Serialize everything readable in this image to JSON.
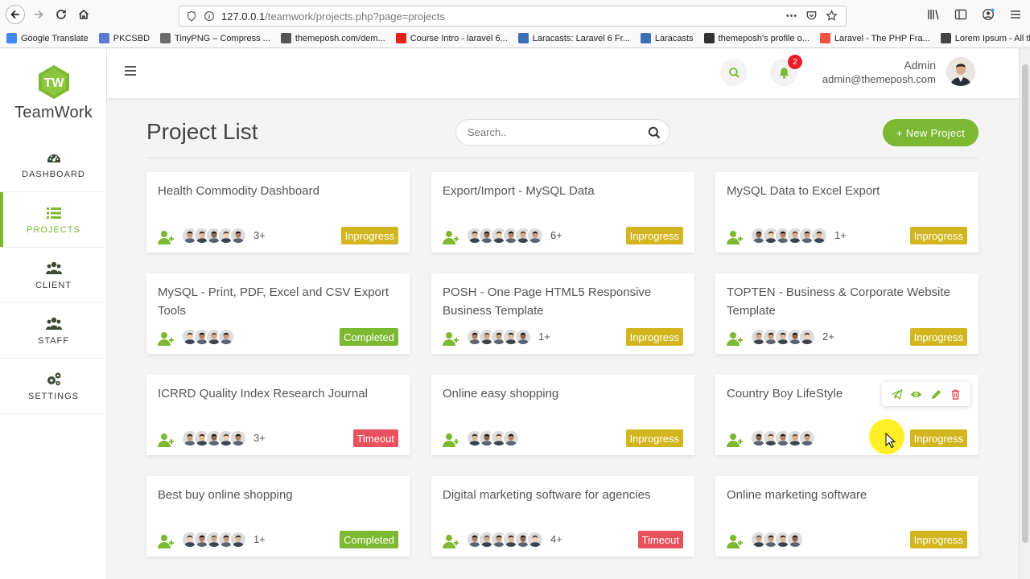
{
  "browser": {
    "url_host": "127.0.0.1",
    "url_path": "/teamwork/projects.php?page=projects",
    "bookmarks": [
      {
        "label": "Google Translate",
        "color": "#4285f4"
      },
      {
        "label": "PKCSBD",
        "color": "#5a7bd1"
      },
      {
        "label": "TinyPNG – Compress ...",
        "color": "#6b6b6b"
      },
      {
        "label": "themeposh.com/dem...",
        "color": "#555555"
      },
      {
        "label": "Course Intro - laravel 6...",
        "color": "#e62117"
      },
      {
        "label": "Laracasts: Laravel 6 Fr...",
        "color": "#3d6fb6"
      },
      {
        "label": "Laracasts",
        "color": "#3d6fb6"
      },
      {
        "label": "themeposh's profile o...",
        "color": "#333333"
      },
      {
        "label": "Laravel - The PHP Fra...",
        "color": "#f05340"
      },
      {
        "label": "Lorem Ipsum - All the ...",
        "color": "#444444"
      }
    ]
  },
  "app": {
    "logo_text": "TeamWork",
    "logo_mark": "TW",
    "accent": "#7cb831"
  },
  "sidebar": {
    "items": [
      {
        "label": "DASHBOARD",
        "icon": "dashboard-gauge-icon",
        "active": false
      },
      {
        "label": "PROJECTS",
        "icon": "list-icon",
        "active": true
      },
      {
        "label": "CLIENT",
        "icon": "users-icon",
        "active": false
      },
      {
        "label": "STAFF",
        "icon": "users-icon",
        "active": false
      },
      {
        "label": "SETTINGS",
        "icon": "gears-icon",
        "active": false
      }
    ]
  },
  "topbar": {
    "notification_count": "2",
    "user_name": "Admin",
    "user_email": "admin@themeposh.com"
  },
  "main": {
    "title": "Project List",
    "search_placeholder": "Search..",
    "new_project_label": "+ New Project"
  },
  "status_colors": {
    "Inprogress": "#d3b61f",
    "Completed": "#7cb831",
    "Timeout": "#e8515d"
  },
  "projects": [
    {
      "title": "Health Commodity Dashboard",
      "faces": 5,
      "more": "3+",
      "status": "Inprogress"
    },
    {
      "title": "Export/Import - MySQL Data",
      "faces": 6,
      "more": "6+",
      "status": "Inprogress"
    },
    {
      "title": "MySQL Data to Excel Export",
      "faces": 6,
      "more": "1+",
      "status": "Inprogress"
    },
    {
      "title": "MySQL - Print, PDF, Excel and CSV Export Tools",
      "faces": 4,
      "more": "",
      "status": "Completed"
    },
    {
      "title": "POSH - One Page HTML5 Responsive Business Template",
      "faces": 5,
      "more": "1+",
      "status": "Inprogress"
    },
    {
      "title": "TOPTEN - Business & Corporate Website Template",
      "faces": 5,
      "more": "2+",
      "status": "Inprogress"
    },
    {
      "title": "ICRRD Quality Index Research Journal",
      "faces": 5,
      "more": "3+",
      "status": "Timeout"
    },
    {
      "title": "Online easy shopping",
      "faces": 4,
      "more": "",
      "status": "Inprogress"
    },
    {
      "title": "Country Boy LifeStyle",
      "faces": 5,
      "more": "",
      "status": "Inprogress"
    },
    {
      "title": "Best buy online shopping",
      "faces": 5,
      "more": "1+",
      "status": "Completed"
    },
    {
      "title": "Digital marketing software for agencies",
      "faces": 6,
      "more": "4+",
      "status": "Timeout"
    },
    {
      "title": "Online marketing software",
      "faces": 4,
      "more": "",
      "status": "Inprogress"
    }
  ],
  "card_actions": [
    "send-icon",
    "eye-icon",
    "pencil-icon",
    "trash-icon"
  ]
}
